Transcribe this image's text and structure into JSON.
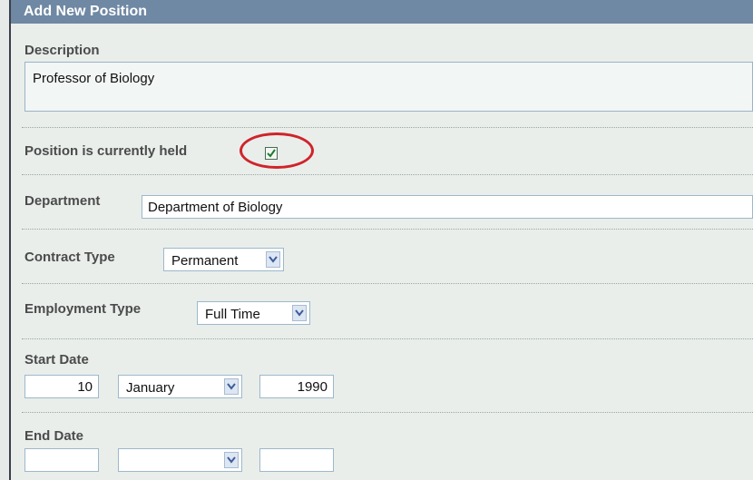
{
  "panel": {
    "title": "Add New Position"
  },
  "description": {
    "label": "Description",
    "value": "Professor of Biology"
  },
  "position_held": {
    "label": "Position is currently held",
    "checked": true
  },
  "department": {
    "label": "Department",
    "value": "Department of Biology"
  },
  "contract_type": {
    "label": "Contract Type",
    "selected": "Permanent"
  },
  "employment_type": {
    "label": "Employment Type",
    "selected": "Full Time"
  },
  "start_date": {
    "label": "Start Date",
    "day": "10",
    "month": "January",
    "year": "1990"
  },
  "end_date": {
    "label": "End Date",
    "day": "",
    "month": "",
    "year": ""
  },
  "annotation": {
    "color": "#d0232a"
  },
  "colors": {
    "header": "#6f88a3",
    "panel": "#e9eeeb",
    "label": "#4b4b4b"
  }
}
